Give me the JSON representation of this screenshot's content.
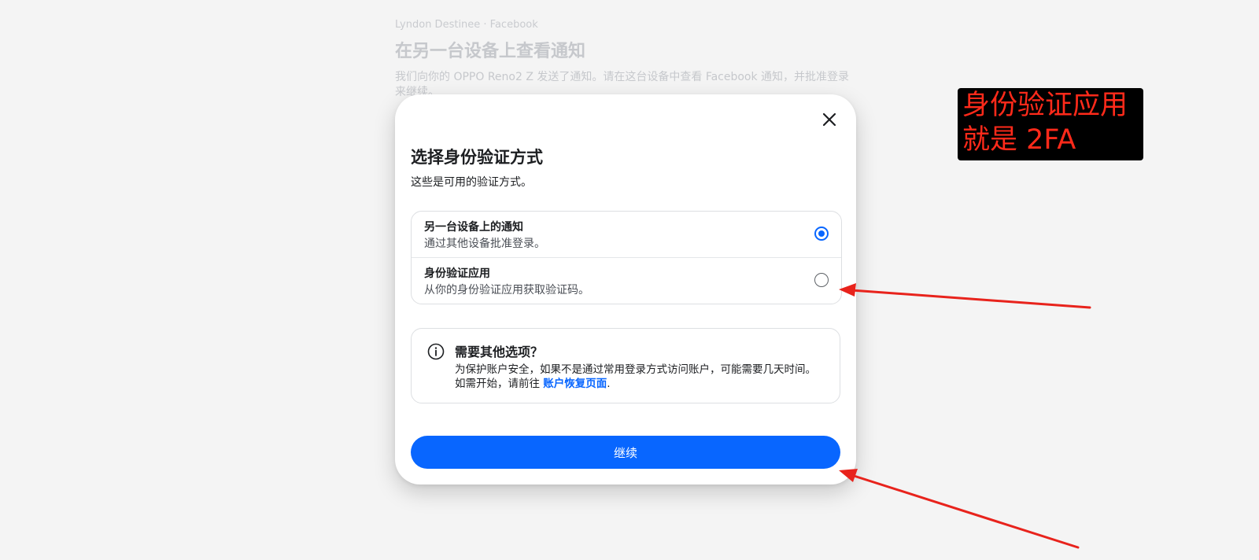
{
  "background_page": {
    "account_label": "Lyndon Destinee · Facebook",
    "title": "在另一台设备上查看通知",
    "description": "我们向你的 OPPO Reno2 Z 发送了通知。请在这台设备中查看 Facebook 通知，并批准登录来继续。"
  },
  "dialog": {
    "close_icon": "close-icon",
    "title": "选择身份验证方式",
    "subtitle": "这些是可用的验证方式。",
    "options": [
      {
        "title": "另一台设备上的通知",
        "description": "通过其他设备批准登录。",
        "selected": true
      },
      {
        "title": "身份验证应用",
        "description": "从你的身份验证应用获取验证码。",
        "selected": false
      }
    ],
    "info": {
      "icon": "info-icon",
      "title": "需要其他选项？",
      "body": "为保护账户安全，如果不是通过常用登录方式访问账户，可能需要几天时间。如需开始，请前往 ",
      "link_label": "账户恢复页面",
      "body_suffix": "."
    },
    "continue_label": "继续"
  },
  "annotation": {
    "line1": "身份验证应用",
    "line2": "就是 2FA",
    "text_color": "#ff2a1a",
    "background": "#000000"
  },
  "colors": {
    "accent": "#0866ff",
    "page_background": "#f4f4f4",
    "arrow": "#e8231c"
  }
}
